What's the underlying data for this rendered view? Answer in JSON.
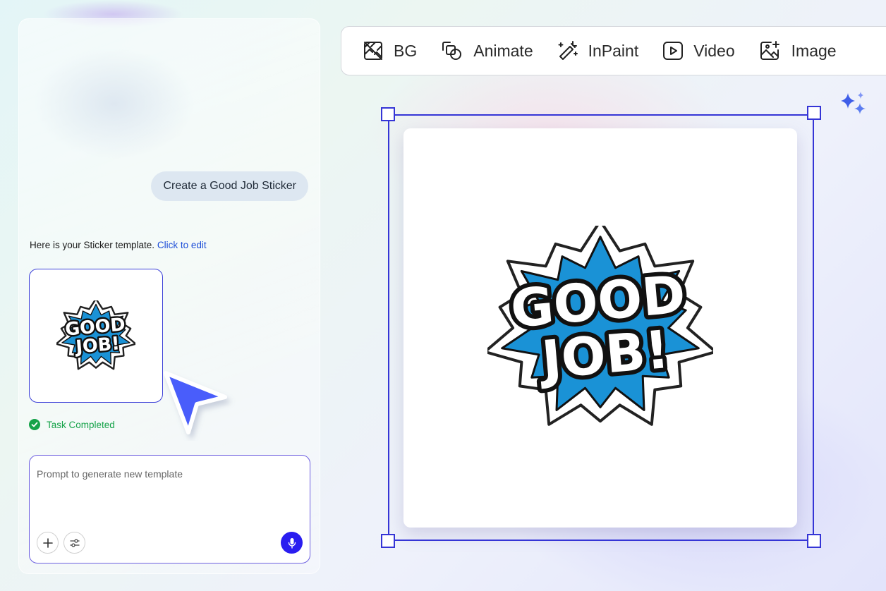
{
  "chat": {
    "user_message": "Create a Good Job Sticker",
    "assistant_message": "Here is your Sticker template.",
    "assistant_link": "Click to edit",
    "status": "Task Completed",
    "prompt_placeholder": "Prompt to generate new template"
  },
  "sticker": {
    "line1": "GOOD",
    "line2": "JOB!",
    "burst_color": "#1a92d6"
  },
  "toolbar": {
    "tools": [
      {
        "label": "BG",
        "icon": "remove-background-icon"
      },
      {
        "label": "Animate",
        "icon": "animate-shapes-icon"
      },
      {
        "label": "InPaint",
        "icon": "magic-wand-icon"
      },
      {
        "label": "Video",
        "icon": "video-play-icon"
      },
      {
        "label": "Image",
        "icon": "add-image-icon"
      }
    ]
  },
  "colors": {
    "accent": "#3535d6",
    "mic_button": "#2a1df0",
    "success": "#16a34a",
    "link": "#1d4ed8"
  }
}
